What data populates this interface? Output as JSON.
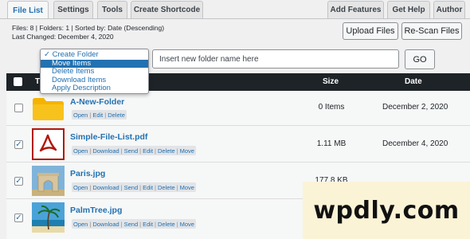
{
  "tabs": {
    "left": [
      "File List",
      "Settings",
      "Tools",
      "Create Shortcode"
    ],
    "right": [
      "Add Features",
      "Get Help",
      "Author"
    ]
  },
  "info": {
    "line1": "Files: 8 | Folders: 1 | Sorted by: Date (Descending)",
    "line2": "Last Changed: December 4, 2020"
  },
  "buttons": {
    "upload": "Upload Files",
    "rescan": "Re-Scan Files",
    "go": "GO"
  },
  "folder_input": {
    "placeholder": "Insert new folder name here"
  },
  "dropdown": {
    "options": [
      "✓ Create Folder",
      "Move Items",
      "Delete Items",
      "Download Items",
      "Apply Description"
    ],
    "selected": "Move Items"
  },
  "table": {
    "headers": {
      "title": "T",
      "size": "Size",
      "date": "Date"
    },
    "rows": [
      {
        "name": "A-New-Folder",
        "type": "folder",
        "checked": false,
        "size": "0 Items",
        "date": "December 2, 2020",
        "actions": [
          "Open",
          "Edit",
          "Delete"
        ]
      },
      {
        "name": "Simple-File-List.pdf",
        "type": "pdf",
        "checked": true,
        "size": "1.11 MB",
        "date": "December 4, 2020",
        "actions": [
          "Open",
          "Download",
          "Send",
          "Edit",
          "Delete",
          "Move"
        ]
      },
      {
        "name": "Paris.jpg",
        "type": "image-paris",
        "checked": true,
        "size": "177.8 KB",
        "date": "",
        "actions": [
          "Open",
          "Download",
          "Send",
          "Edit",
          "Delete",
          "Move"
        ]
      },
      {
        "name": "PalmTree.jpg",
        "type": "image-palm",
        "checked": true,
        "size": "",
        "date": "",
        "actions": [
          "Open",
          "Download",
          "Send",
          "Edit",
          "Delete",
          "Move"
        ]
      }
    ]
  },
  "watermark": {
    "text": "wpdly.com"
  },
  "colors": {
    "accent": "#2271b1",
    "header_bg": "#1d2327",
    "folder": "#f5b301",
    "pdf_red": "#b0160a"
  }
}
